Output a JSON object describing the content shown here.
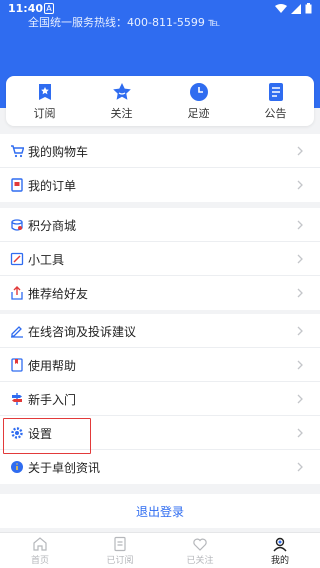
{
  "status_bar": {
    "time": "11:40",
    "notification_glyph": "A"
  },
  "header": {
    "hotline": "全国统一服务热线：400-811-5599 ℡"
  },
  "quick_actions": [
    {
      "label": "订阅",
      "icon": "bookmark-star-icon"
    },
    {
      "label": "关注",
      "icon": "star-icon"
    },
    {
      "label": "足迹",
      "icon": "clock-icon"
    },
    {
      "label": "公告",
      "icon": "notice-icon"
    }
  ],
  "menu": {
    "cart": "我的购物车",
    "orders": "我的订单",
    "points_mall": "积分商城",
    "tools": "小工具",
    "recommend": "推荐给好友",
    "consult": "在线咨询及投诉建议",
    "help": "使用帮助",
    "newbie": "新手入门",
    "settings": "设置",
    "about": "关于卓创资讯"
  },
  "logout_label": "退出登录",
  "tabbar": [
    {
      "label": "首页",
      "active": false
    },
    {
      "label": "已订阅",
      "active": false
    },
    {
      "label": "已关注",
      "active": false
    },
    {
      "label": "我的",
      "active": true
    }
  ],
  "colors": {
    "accent": "#2f6cf0",
    "highlight_border": "#e23a3a"
  }
}
